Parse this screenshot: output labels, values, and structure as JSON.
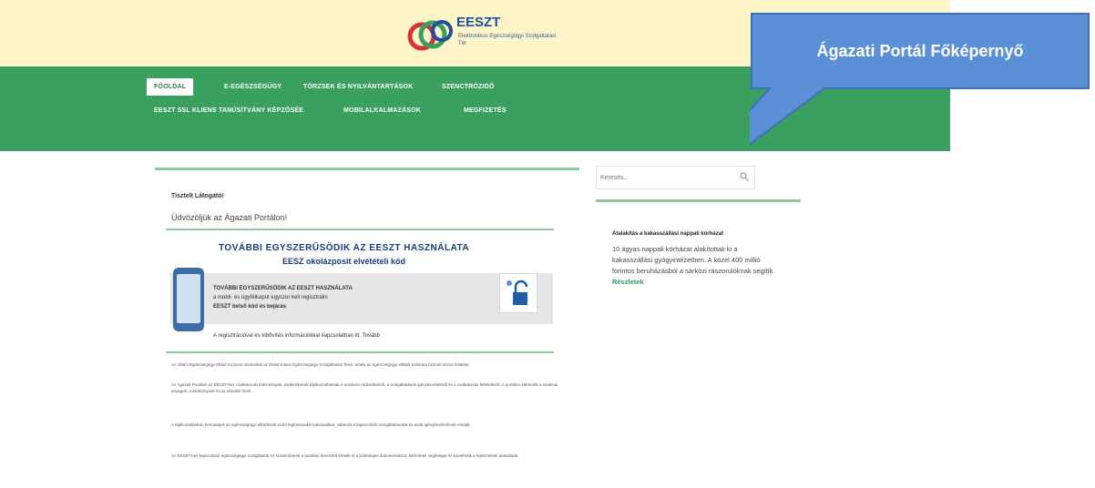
{
  "logo": {
    "title": "EESZT",
    "subtitle": "Elektronikus Egészségügyi Szolgáltatási Tér"
  },
  "nav": {
    "items": [
      {
        "label": "FŐOLDAL",
        "active": true
      },
      {
        "label": "E-EGÉSZSÉGÜGY",
        "active": false
      },
      {
        "label": "TÖRZSEK ÉS NYILVÁNTARTÁSOK",
        "active": false
      },
      {
        "label": "SZENCTRÓZIDŐ",
        "active": false
      },
      {
        "label": "EESZT SSL KLIENS TANÚSÍTVÁNY KÉPZŐSÉE",
        "active": false
      },
      {
        "label": "MOBILALKALMAZÁSOK",
        "active": false
      },
      {
        "label": "MEGFIZETÉS",
        "active": false
      }
    ]
  },
  "search": {
    "placeholder": "Keresés..."
  },
  "breadcrumb": "Tisztelt Látogató!",
  "page_title": "Üdvözöljük az Ágazati Portálon!",
  "banner": {
    "headline": "TOVÁBBI EGYSZERŰSÖDIK AZ EESZT HASZNÁLATA",
    "subheadline": "EESZ okolázposit elvétételi kód",
    "line1": "TOVÁBBI EGYSZERŰSÖDIK AZ EESZT HASZNÁLATA",
    "line2": "a mobil- és ügyfélkaput egyszer kell regisztrálni",
    "line3": "EESZT belső kód és bejárás",
    "footer": "A regisztrációval és kibővítés információkkal kapcsolatban itt: Tovább"
  },
  "paragraphs": [
    "Az Állami Egészségügyi Ellátó Központ üzemelteti az Elektronikus Egészségügyi Szolgáltatási Teret, amely az egészségügyi ellátók számára biztosít közös felületet.",
    "Az Ágazati Portálon az EESZT-hez csatlakozott intézmények, szakemberek tájékozódhatnak a rendszer működéséről, a szolgáltatások igénybevételéről és a csatlakozás feltételeiről. A portálon elérhetők a szakmai anyagok, a kézikönyvek és az aktuális hírek.",
    "A tájékoztatásban bemutatjuk az egészségügyi ellátóknak szóló legfontosabb tudnivalókat, valamint a kapcsolódó szolgáltatásokat és azok igénybevételének módját.",
    "Az EESZT-hez kapcsolódó egészségügyi szolgáltatók és szakemberek a portálon keresztül érhetik el a szükséges dokumentációt, kérhetnek segítséget és követhetik a fejlesztések alakulását."
  ],
  "sidebar": {
    "title": "Átalakítás a kakasszállási nappali kórházat",
    "text": "10 ágyas nappali kórházat alakítottak ki a kakasszállási gyógyintézetben. A közel 400 millió forintos beruházásból a sárközi rászorulóknak segítik.",
    "link": "Részletek"
  },
  "callout": {
    "text": "Ágazati Portál Főképernyő",
    "color": "#5b8fd6",
    "border": "#3e6fb8"
  },
  "colors": {
    "nav_green": "#3aa05f",
    "header_yellow": "#fdf4c8",
    "accent_blue": "#1a3a7a"
  }
}
